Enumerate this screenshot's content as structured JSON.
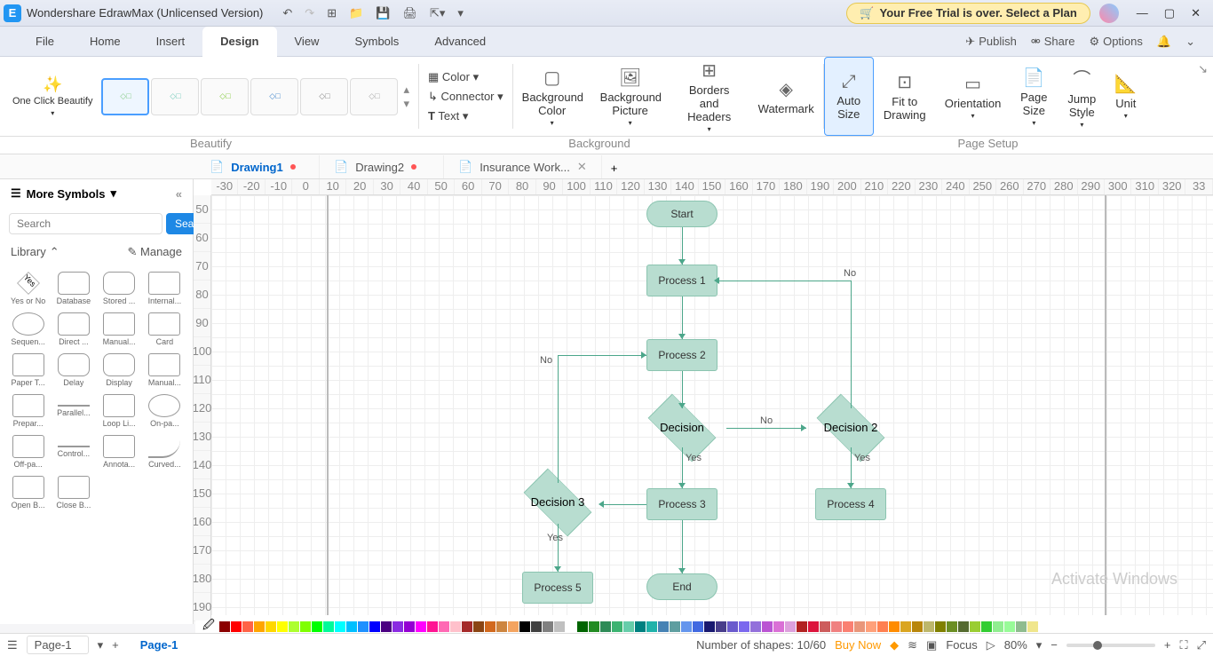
{
  "titlebar": {
    "app": "Wondershare EdrawMax (Unlicensed Version)",
    "trial": "Your Free Trial is over. Select a Plan"
  },
  "menus": {
    "file": "File",
    "home": "Home",
    "insert": "Insert",
    "design": "Design",
    "view": "View",
    "symbols": "Symbols",
    "advanced": "Advanced",
    "publish": "Publish",
    "share": "Share",
    "options": "Options"
  },
  "ribbon": {
    "oneclick": "One Click Beautify",
    "color": "Color",
    "connector": "Connector",
    "text": "Text",
    "bgcolor": "Background Color",
    "bgpic": "Background Picture",
    "borders": "Borders and Headers",
    "watermark": "Watermark",
    "autosize": "Auto Size",
    "fit": "Fit to Drawing",
    "orientation": "Orientation",
    "pagesize": "Page Size",
    "jumpstyle": "Jump Style",
    "unit": "Unit",
    "grp_beautify": "Beautify",
    "grp_bg": "Background",
    "grp_page": "Page Setup"
  },
  "tabs": [
    {
      "name": "Drawing1",
      "mod": true,
      "active": true
    },
    {
      "name": "Drawing2",
      "mod": true,
      "active": false
    },
    {
      "name": "Insurance Work...",
      "mod": false,
      "active": false
    }
  ],
  "sidebar": {
    "title": "More Symbols",
    "search_ph": "Search",
    "search_btn": "Search",
    "library": "Library",
    "manage": "Manage",
    "shapes": [
      {
        "l": "Yes or No",
        "t": "diam",
        "txt": "Yes"
      },
      {
        "l": "Database",
        "t": "cyl"
      },
      {
        "l": "Stored ...",
        "t": "round"
      },
      {
        "l": "Internal...",
        "t": "proc"
      },
      {
        "l": "Sequen...",
        "t": "ell"
      },
      {
        "l": "Direct ...",
        "t": "cyl"
      },
      {
        "l": "Manual...",
        "t": "proc"
      },
      {
        "l": "Card",
        "t": "proc"
      },
      {
        "l": "Paper T...",
        "t": "proc"
      },
      {
        "l": "Delay",
        "t": "round"
      },
      {
        "l": "Display",
        "t": "round"
      },
      {
        "l": "Manual...",
        "t": "proc"
      },
      {
        "l": "Prepar...",
        "t": "proc"
      },
      {
        "l": "Parallel...",
        "t": "line"
      },
      {
        "l": "Loop Li...",
        "t": "proc"
      },
      {
        "l": "On-pa...",
        "t": "ell"
      },
      {
        "l": "Off-pa...",
        "t": "proc"
      },
      {
        "l": "Control...",
        "t": "line"
      },
      {
        "l": "Annota...",
        "t": "proc"
      },
      {
        "l": "Curved...",
        "t": "curve"
      },
      {
        "l": "Open B...",
        "t": "proc"
      },
      {
        "l": "Close B...",
        "t": "proc"
      }
    ]
  },
  "flowchart": {
    "start": "Start",
    "p1": "Process 1",
    "p2": "Process 2",
    "dec": "Decision",
    "dec2": "Decision 2",
    "dec3": "Decision 3",
    "p3": "Process 3",
    "p4": "Process 4",
    "p5": "Process 5",
    "end": "End",
    "yes": "Yes",
    "no": "No"
  },
  "watermark_txt": "Activate Windows",
  "status": {
    "page": "Page-1",
    "shapes": "Number of shapes: 10/60",
    "buy": "Buy Now",
    "focus": "Focus",
    "zoom": "80%"
  },
  "ruler_h": [
    "-30",
    "-20",
    "-10",
    "0",
    "10",
    "20",
    "30",
    "40",
    "50",
    "60",
    "70",
    "80",
    "90",
    "100",
    "110",
    "120",
    "130",
    "140",
    "150",
    "160",
    "170",
    "180",
    "190",
    "200",
    "210",
    "220",
    "230",
    "240",
    "250",
    "260",
    "270",
    "280",
    "290",
    "300",
    "310",
    "320",
    "33"
  ],
  "ruler_v": [
    "50",
    "60",
    "70",
    "80",
    "90",
    "100",
    "110",
    "120",
    "130",
    "140",
    "150",
    "160",
    "170",
    "180",
    "190"
  ],
  "colors": [
    "#8b0000",
    "#ff0000",
    "#ff6347",
    "#ffa500",
    "#ffd700",
    "#ffff00",
    "#adff2f",
    "#7fff00",
    "#00ff00",
    "#00fa9a",
    "#00ffff",
    "#00bfff",
    "#1e90ff",
    "#0000ff",
    "#4b0082",
    "#8a2be2",
    "#9400d3",
    "#ff00ff",
    "#ff1493",
    "#ff69b4",
    "#ffc0cb",
    "#a52a2a",
    "#8b4513",
    "#d2691e",
    "#cd853f",
    "#f4a460",
    "#000000",
    "#404040",
    "#808080",
    "#c0c0c0",
    "#ffffff",
    "#006400",
    "#228b22",
    "#2e8b57",
    "#3cb371",
    "#66cdaa",
    "#008080",
    "#20b2aa",
    "#4682b4",
    "#5f9ea0",
    "#6495ed",
    "#4169e1",
    "#191970",
    "#483d8b",
    "#6a5acd",
    "#7b68ee",
    "#9370db",
    "#ba55d3",
    "#da70d6",
    "#dda0dd",
    "#b22222",
    "#dc143c",
    "#cd5c5c",
    "#f08080",
    "#fa8072",
    "#e9967a",
    "#ffa07a",
    "#ff7f50",
    "#ff8c00",
    "#daa520",
    "#b8860b",
    "#bdb76b",
    "#808000",
    "#6b8e23",
    "#556b2f",
    "#9acd32",
    "#32cd32",
    "#90ee90",
    "#98fb98",
    "#8fbc8f",
    "#f0e68c"
  ]
}
